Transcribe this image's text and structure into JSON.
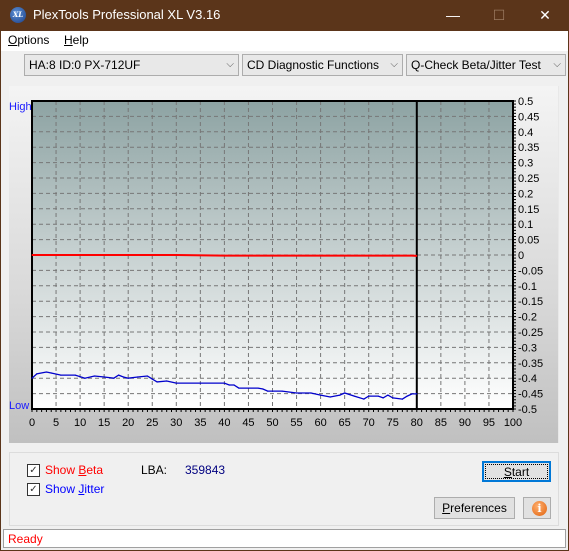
{
  "window": {
    "title": "PlexTools Professional XL V3.16",
    "icon": "xl-app-icon",
    "icon_text": "XL",
    "controls": {
      "minimize": "—",
      "maximize": "☐",
      "close": "✕"
    }
  },
  "menu": [
    {
      "label": "Options",
      "accel": "O",
      "rest": "ptions"
    },
    {
      "label": "Help",
      "accel": "H",
      "rest": "elp"
    }
  ],
  "toolbar": {
    "drive_select": "HA:8 ID:0  PX-712UF",
    "function_select": "CD Diagnostic Functions",
    "test_select": "Q-Check Beta/Jitter Test",
    "chevron": "⌵"
  },
  "chart_labels": {
    "high": "High",
    "low": "Low"
  },
  "chart_data": {
    "type": "line",
    "title": "",
    "xlabel": "",
    "ylabel": "",
    "xlim": [
      0,
      100
    ],
    "ylim": [
      -0.5,
      0.5
    ],
    "x_ticks": [
      "0",
      "5",
      "10",
      "15",
      "20",
      "25",
      "30",
      "35",
      "40",
      "45",
      "50",
      "55",
      "60",
      "65",
      "70",
      "75",
      "80",
      "85",
      "90",
      "95",
      "100"
    ],
    "y_ticks_right": [
      "0.5",
      "0.45",
      "0.4",
      "0.35",
      "0.3",
      "0.25",
      "0.2",
      "0.15",
      "0.1",
      "0.05",
      "0",
      "-0.05",
      "-0.1",
      "-0.15",
      "-0.2",
      "-0.25",
      "-0.3",
      "-0.35",
      "-0.4",
      "-0.45",
      "-0.5"
    ],
    "left_axis_labels": {
      "top": "High",
      "bottom": "Low"
    },
    "grid": true,
    "end_marker_x": 80,
    "series": [
      {
        "name": "Beta",
        "color": "#ff0000",
        "x": [
          0,
          5,
          10,
          20,
          30,
          40,
          50,
          60,
          70,
          79,
          80
        ],
        "values": [
          0.0,
          0.0,
          0.0,
          0.0,
          0.0,
          -0.002,
          -0.002,
          -0.002,
          -0.002,
          -0.002,
          -0.003
        ]
      },
      {
        "name": "Jitter",
        "color": "#0000cc",
        "x": [
          0,
          1,
          3,
          4,
          6,
          9,
          11,
          13,
          15,
          17,
          18,
          19,
          20,
          22,
          24,
          25,
          26,
          28,
          30,
          35,
          40,
          41,
          42,
          43,
          47,
          48,
          49,
          52,
          55,
          58,
          60,
          62,
          64,
          65,
          67,
          69,
          70,
          72,
          73,
          74,
          75,
          77,
          78,
          79,
          80
        ],
        "values": [
          -0.4,
          -0.386,
          -0.38,
          -0.383,
          -0.39,
          -0.39,
          -0.4,
          -0.393,
          -0.396,
          -0.4,
          -0.39,
          -0.396,
          -0.4,
          -0.396,
          -0.393,
          -0.403,
          -0.412,
          -0.409,
          -0.416,
          -0.416,
          -0.416,
          -0.422,
          -0.422,
          -0.432,
          -0.432,
          -0.435,
          -0.442,
          -0.442,
          -0.448,
          -0.448,
          -0.455,
          -0.461,
          -0.455,
          -0.448,
          -0.458,
          -0.468,
          -0.458,
          -0.458,
          -0.464,
          -0.455,
          -0.464,
          -0.468,
          -0.458,
          -0.451,
          -0.451
        ]
      }
    ]
  },
  "options": {
    "show_beta": {
      "label_pre": "Show ",
      "accel": "B",
      "label_post": "eta",
      "checked": true,
      "color": "#ff0000"
    },
    "show_jitter": {
      "label_pre": "Show ",
      "accel": "J",
      "label_post": "itter",
      "checked": true,
      "color": "#0000ff"
    },
    "lba_label": "LBA:",
    "lba_value": "359843"
  },
  "buttons": {
    "start": {
      "accel": "S",
      "rest": "tart"
    },
    "preferences": {
      "accel": "P",
      "rest": "references"
    },
    "info": "i"
  },
  "status": {
    "text": "Ready",
    "color": "#ff0000"
  }
}
